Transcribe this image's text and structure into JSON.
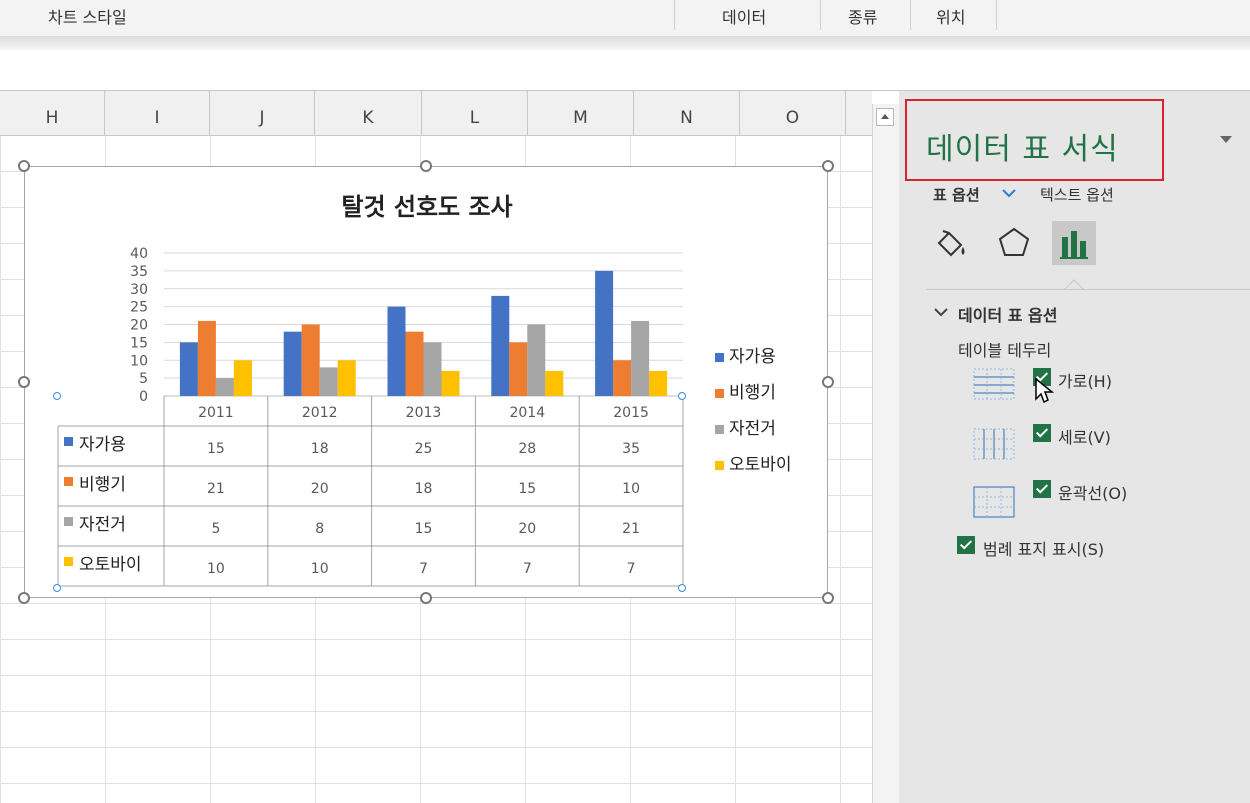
{
  "ribbon": {
    "chart_styles": "차트 스타일",
    "data": "데이터",
    "type": "종류",
    "location": "위치"
  },
  "columns": [
    "H",
    "I",
    "J",
    "K",
    "L",
    "M",
    "N",
    "O"
  ],
  "chart_data": {
    "type": "bar",
    "title": "탈것 선호도 조사",
    "categories": [
      "2011",
      "2012",
      "2013",
      "2014",
      "2015"
    ],
    "series": [
      {
        "name": "자가용",
        "values": [
          15,
          18,
          25,
          28,
          35
        ],
        "color": "#4472c4"
      },
      {
        "name": "비행기",
        "values": [
          21,
          20,
          18,
          15,
          10
        ],
        "color": "#ed7d31"
      },
      {
        "name": "자전거",
        "values": [
          5,
          8,
          15,
          20,
          21
        ],
        "color": "#a5a5a5"
      },
      {
        "name": "오토바이",
        "values": [
          10,
          10,
          7,
          7,
          7
        ],
        "color": "#ffc000"
      }
    ],
    "y_ticks": [
      0,
      5,
      10,
      15,
      20,
      25,
      30,
      35,
      40
    ],
    "ylim": [
      0,
      40
    ],
    "grid": true,
    "legend": "right",
    "data_table": true
  },
  "pane": {
    "title": "데이터 표 서식",
    "tab_table_options": "표 옵션",
    "tab_text_options": "텍스트 옵션",
    "icons": [
      "fill-line-icon",
      "effects-pentagon-icon",
      "chart-options-icon"
    ],
    "section_title": "데이터 표 옵션",
    "table_border_label": "테이블 테두리",
    "options": [
      {
        "label": "가로(H)",
        "checked": true
      },
      {
        "label": "세로(V)",
        "checked": true
      },
      {
        "label": "윤곽선(O)",
        "checked": true
      }
    ],
    "show_legend_keys": {
      "label": "범례 표지 표시(S)",
      "checked": true
    },
    "accent": "#217346"
  }
}
